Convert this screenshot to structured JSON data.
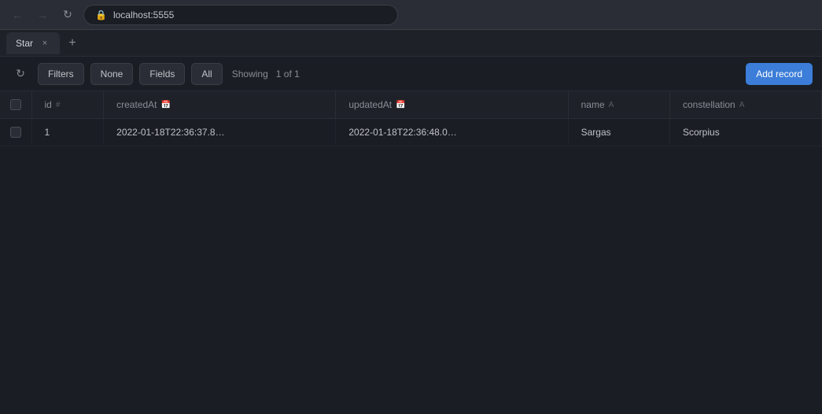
{
  "browser": {
    "url": "localhost:5555",
    "back_disabled": true,
    "forward_disabled": true
  },
  "tab": {
    "label": "Star",
    "close_label": "×",
    "new_tab_label": "+"
  },
  "toolbar": {
    "refresh_icon": "↻",
    "filters_label": "Filters",
    "none_label": "None",
    "fields_label": "Fields",
    "all_label": "All",
    "showing_label": "Showing",
    "showing_value": "1 of 1",
    "add_record_label": "Add record"
  },
  "table": {
    "columns": [
      {
        "key": "checkbox",
        "label": ""
      },
      {
        "key": "id",
        "label": "id",
        "icon": "#"
      },
      {
        "key": "createdAt",
        "label": "createdAt",
        "icon": "📅"
      },
      {
        "key": "updatedAt",
        "label": "updatedAt",
        "icon": "📅"
      },
      {
        "key": "name",
        "label": "name",
        "icon": "A"
      },
      {
        "key": "constellation",
        "label": "constellation",
        "icon": "A"
      }
    ],
    "rows": [
      {
        "checkbox": "",
        "id": "1",
        "createdAt": "2022-01-18T22:36:37.8…",
        "updatedAt": "2022-01-18T22:36:48.0…",
        "name": "Sargas",
        "constellation": "Scorpius"
      }
    ]
  }
}
